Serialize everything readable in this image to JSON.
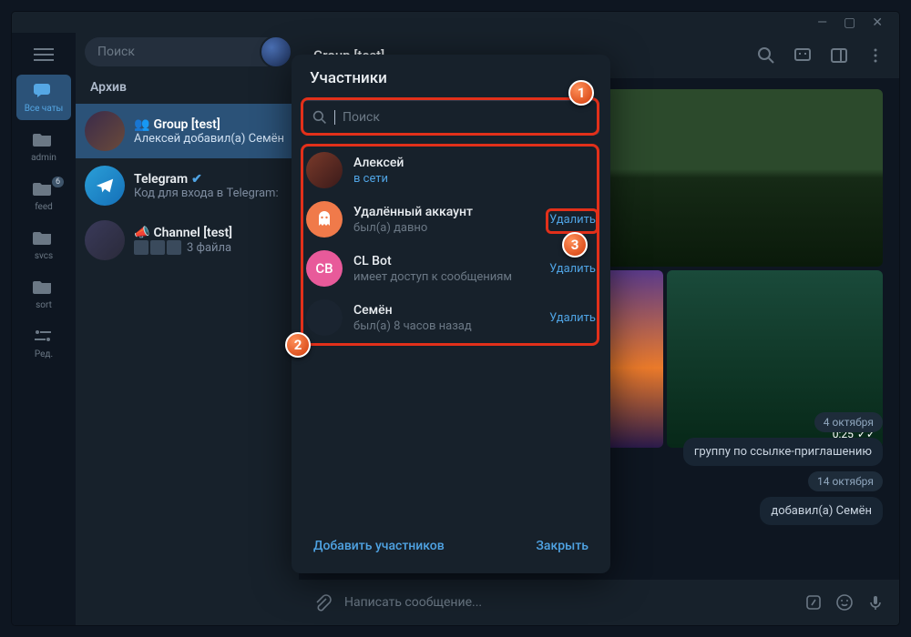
{
  "search": {
    "placeholder": "Поиск"
  },
  "rail": {
    "items": [
      {
        "label": "Все чаты"
      },
      {
        "label": "admin"
      },
      {
        "label": "feed",
        "badge": "6"
      },
      {
        "label": "svcs"
      },
      {
        "label": "sort"
      },
      {
        "label": "Ред."
      }
    ]
  },
  "archive": "Архив",
  "chats": [
    {
      "name": "Group [test]",
      "sub": "Алексей добавил(а) Семён"
    },
    {
      "name": "Telegram",
      "sub": "Код для входа в Telegram:"
    },
    {
      "name": "Channel [test]",
      "sub": "3 файла"
    }
  ],
  "header": {
    "title": "Group [test]"
  },
  "video_duration": "0:25",
  "timeline": {
    "date1": "4 октября",
    "msg1": "группу по ссылке-приглашению",
    "date2": "14 октября",
    "msg2": "добавил(а) Семён"
  },
  "composer": {
    "placeholder": "Написать сообщение..."
  },
  "modal": {
    "title": "Участники",
    "search_placeholder": "Поиск",
    "members": [
      {
        "name": "Алексей",
        "status": "в сети",
        "online": true
      },
      {
        "name": "Удалённый аккаунт",
        "status": "был(а) давно",
        "delete": "Удалить"
      },
      {
        "name": "CL Bot",
        "initials": "CB",
        "status": "имеет доступ к сообщениям",
        "delete": "Удалить"
      },
      {
        "name": "Семён",
        "status": "был(а) 8 часов назад",
        "delete": "Удалить"
      }
    ],
    "add": "Добавить участников",
    "close": "Закрыть"
  },
  "callouts": {
    "c1": "1",
    "c2": "2",
    "c3": "3"
  }
}
